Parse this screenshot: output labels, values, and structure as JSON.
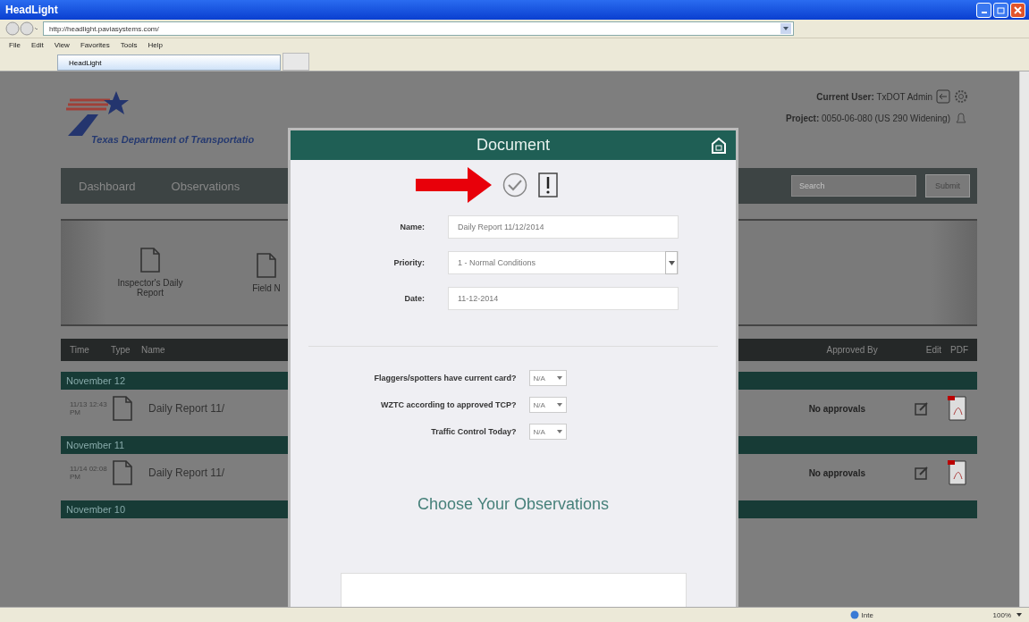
{
  "window": {
    "title": "HeadLight"
  },
  "browser": {
    "url": "http://headlight.paviasystems.com/",
    "menu": [
      "File",
      "Edit",
      "View",
      "Favorites",
      "Tools",
      "Help"
    ],
    "tab": "HeadLight"
  },
  "page": {
    "logo_text": "Texas Department of Transportatio",
    "current_user_label": "Current User:",
    "current_user": "TxDOT Admin",
    "project_label": "Project:",
    "project": "0050-06-080 (US 290 Widening)",
    "nav": [
      "Dashboard",
      "Observations"
    ],
    "search": {
      "placeholder": "Search"
    },
    "submit": "Submit",
    "carousel": [
      "Inspector's Daily Report",
      "Field N"
    ],
    "columns": [
      "Time",
      "Type",
      "Name",
      "Approved By",
      "Edit",
      "PDF"
    ],
    "groups": [
      {
        "date": "November 12",
        "rows": [
          {
            "time": "11/13 12:43 PM",
            "name": "Daily Report 11/",
            "approval": "No approvals"
          }
        ]
      },
      {
        "date": "November 11",
        "rows": [
          {
            "time": "11/14 02:08 PM",
            "name": "Daily Report 11/",
            "approval": "No approvals"
          }
        ]
      },
      {
        "date": "November 10"
      }
    ]
  },
  "modal": {
    "title": "Document",
    "fields": [
      {
        "label": "Name:",
        "value": "Daily Report 11/12/2014",
        "kind": "text"
      },
      {
        "label": "Priority:",
        "value": "1 - Normal Conditions",
        "kind": "select"
      },
      {
        "label": "Date:",
        "value": "11-12-2014",
        "kind": "text"
      }
    ],
    "questions": [
      {
        "label": "Flaggers/spotters have current card?",
        "value": "N/A"
      },
      {
        "label": "WZTC according to approved TCP?",
        "value": "N/A"
      },
      {
        "label": "Traffic Control Today?",
        "value": "N/A"
      }
    ],
    "section_title": "Choose Your Observations"
  },
  "status_bar": {
    "zone": "Inte",
    "zoom": "100%"
  }
}
